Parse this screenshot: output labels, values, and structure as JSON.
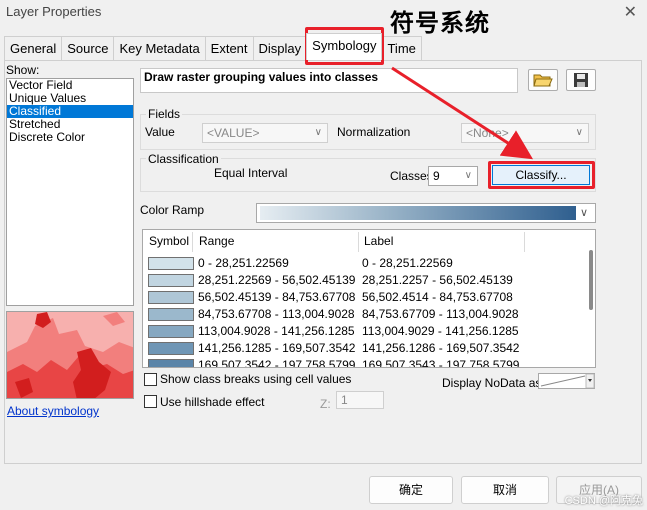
{
  "window": {
    "title": "Layer Properties",
    "close_glyph": "✕"
  },
  "annotation": {
    "text": "符号系统"
  },
  "tabs": [
    {
      "label": "General"
    },
    {
      "label": "Source"
    },
    {
      "label": "Key Metadata"
    },
    {
      "label": "Extent"
    },
    {
      "label": "Display"
    },
    {
      "label": "Symbology",
      "active": true
    },
    {
      "label": "Time"
    }
  ],
  "show": {
    "label": "Show:",
    "items": [
      "Vector Field",
      "Unique Values",
      "Classified",
      "Stretched",
      "Discrete Color"
    ],
    "selected": "Classified"
  },
  "description": "Draw raster grouping values into classes",
  "icons": {
    "open": "folder-open-icon",
    "save": "save-disk-icon"
  },
  "fields": {
    "group_label": "Fields",
    "value_label": "Value",
    "value_selected": "<VALUE>",
    "normalization_label": "Normalization",
    "normalization_selected": "<None>"
  },
  "classification": {
    "group_label": "Classification",
    "method": "Equal Interval",
    "classes_label": "Classes",
    "classes_value": "9",
    "classify_button": "Classify..."
  },
  "color_ramp": {
    "label": "Color Ramp",
    "colors": [
      "#e6edf2",
      "#9ab4c8",
      "#2f5f8f"
    ]
  },
  "table": {
    "headers": {
      "symbol": "Symbol",
      "range": "Range",
      "label": "Label"
    },
    "rows": [
      {
        "color": "#d2e2ea",
        "range": "0 - 28,251.22569",
        "label": "0 - 28,251.22569"
      },
      {
        "color": "#c1d5e1",
        "range": "28,251.22569 - 56,502.45139",
        "label": "28,251.2257 - 56,502.45139"
      },
      {
        "color": "#afc7d7",
        "range": "56,502.45139 - 84,753.67708",
        "label": "56,502.4514 - 84,753.67708"
      },
      {
        "color": "#9bb8cc",
        "range": "84,753.67708 - 113,004.9028",
        "label": "84,753.67709 - 113,004.9028"
      },
      {
        "color": "#86a8c1",
        "range": "113,004.9028 - 141,256.1285",
        "label": "113,004.9029 - 141,256.1285"
      },
      {
        "color": "#6f96b5",
        "range": "141,256.1285 - 169,507.3542",
        "label": "141,256.1286 - 169,507.3542"
      },
      {
        "color": "#5a84a8",
        "range": "169,507.3542 - 197,758.5799",
        "label": "169,507.3543 - 197,758.5799"
      }
    ]
  },
  "options": {
    "show_breaks": "Show class breaks using cell values",
    "hillshade": "Use hillshade effect",
    "z_label": "Z:",
    "z_value": "1",
    "nodata_label": "Display NoData as"
  },
  "about_link": "About symbology",
  "buttons": {
    "ok": "确定",
    "cancel": "取消",
    "apply": "应用(A)"
  },
  "watermark": "CSDN @阿克兔"
}
